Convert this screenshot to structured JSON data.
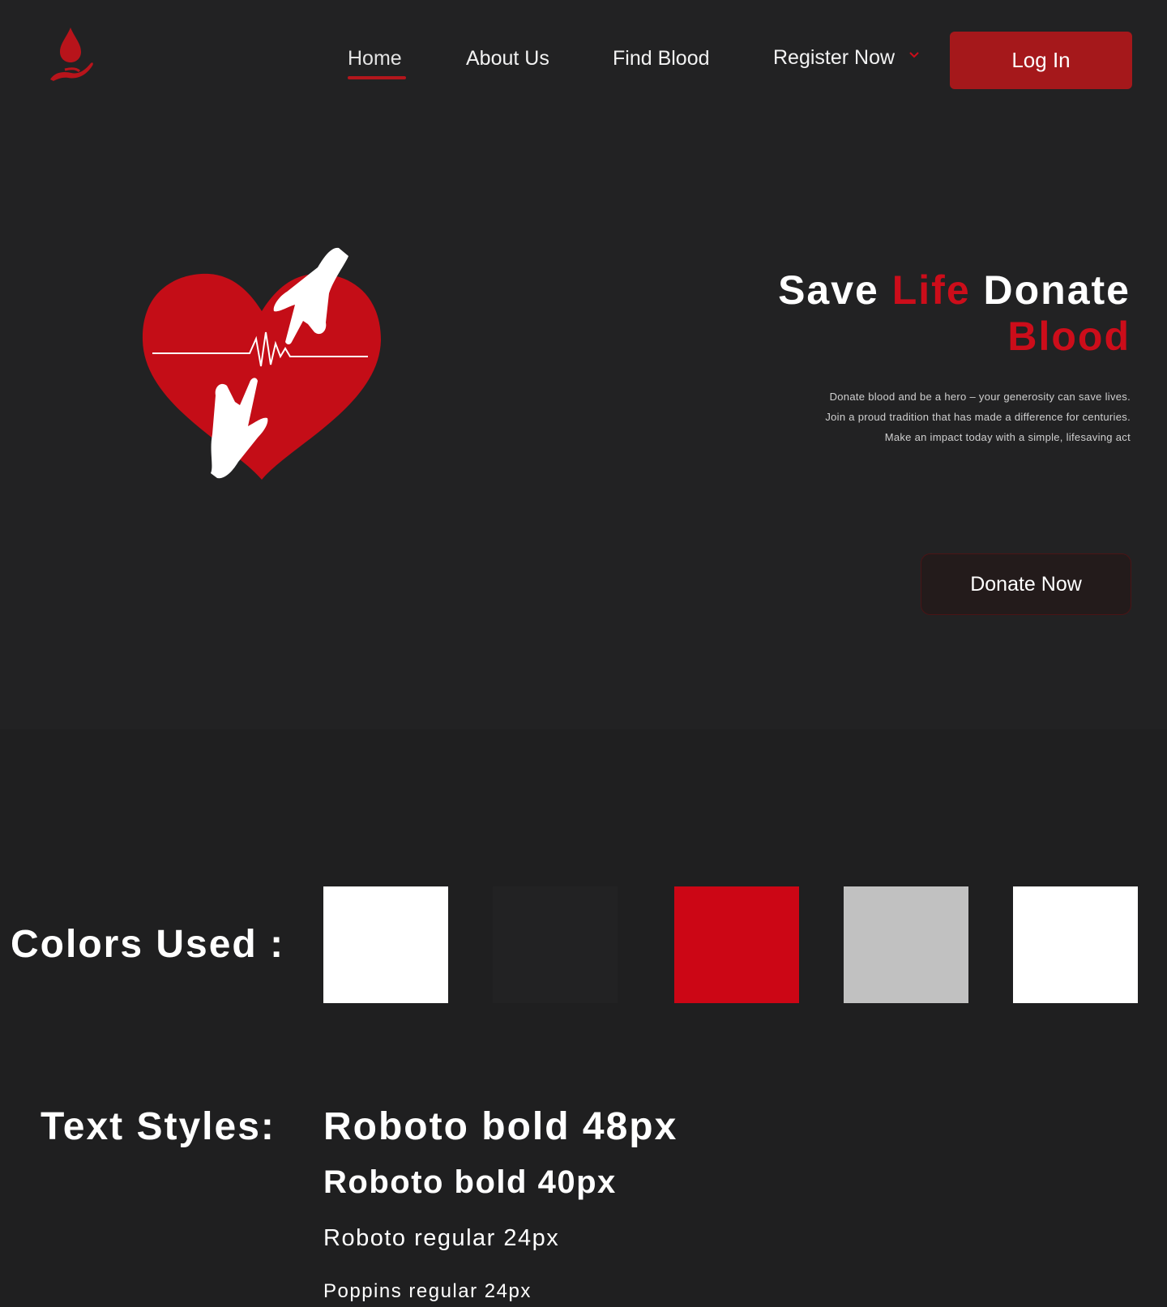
{
  "nav": {
    "items": [
      {
        "label": "Home",
        "active": true
      },
      {
        "label": "About Us"
      },
      {
        "label": "Find Blood"
      },
      {
        "label": "Register Now",
        "has_dropdown": true
      }
    ],
    "login_label": "Log In",
    "logo_icon": "blood-drop-hand-icon"
  },
  "hero": {
    "title_part1": "Save ",
    "title_part2": "Life",
    "title_part3": " Donate",
    "title_part4": "Blood",
    "description_lines": [
      "Donate blood and be a hero – your generosity can save lives.",
      "Join a proud tradition that has made a difference for centuries.",
      "Make an impact today with a simple, lifesaving act"
    ],
    "donate_label": "Donate Now",
    "illustration": "heart-hands-pulse-icon"
  },
  "colors_section": {
    "label": "Colors Used :",
    "swatches": [
      "#ffffff",
      "#222223",
      "#cc0615",
      "#c1c1c1",
      "#ffffff"
    ]
  },
  "text_styles": {
    "label": "Text Styles:",
    "samples": [
      "Roboto bold 48px",
      "Roboto bold 40px",
      "Roboto regular 24px",
      "Poppins regular 24px"
    ]
  },
  "theme": {
    "accent": "#cc0d1a",
    "button_red": "#a5181b",
    "background": "#222223"
  }
}
